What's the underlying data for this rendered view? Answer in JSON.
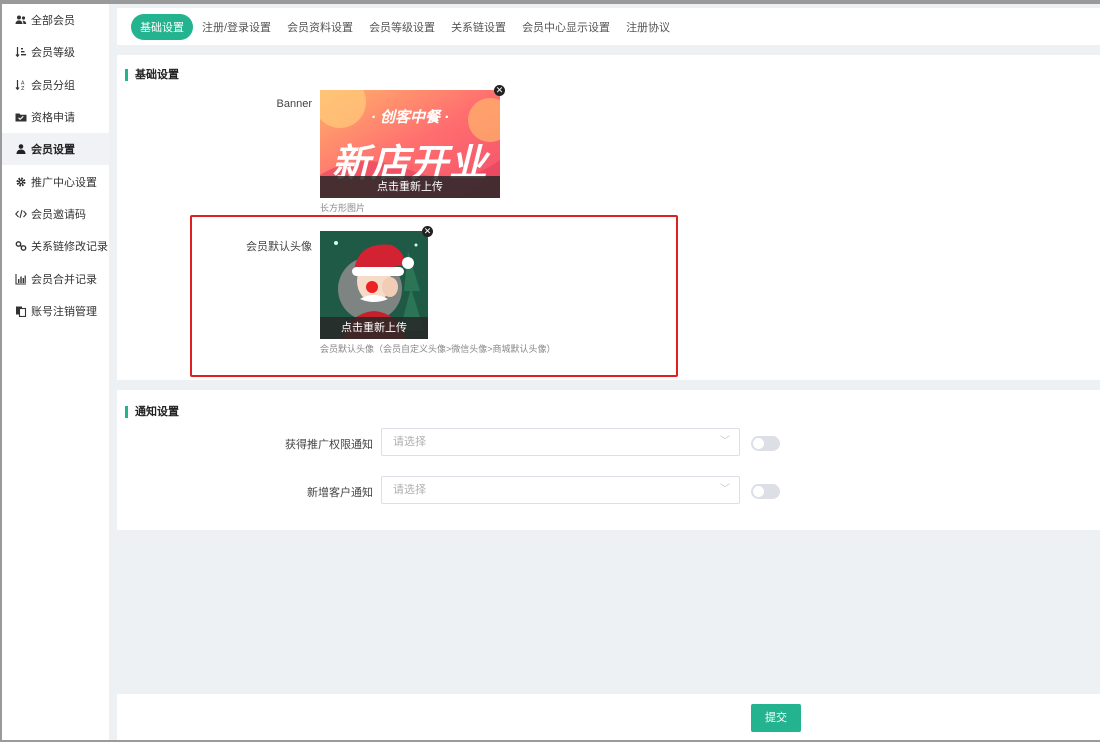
{
  "sidebar": {
    "items": [
      {
        "label": "全部会员",
        "icon": "users-icon"
      },
      {
        "label": "会员等级",
        "icon": "sort-amount-icon"
      },
      {
        "label": "会员分组",
        "icon": "sort-alpha-icon"
      },
      {
        "label": "资格申请",
        "icon": "folder-check-icon"
      },
      {
        "label": "会员设置",
        "icon": "user-icon",
        "active": true
      },
      {
        "label": "推广中心设置",
        "icon": "gear-icon"
      },
      {
        "label": "会员邀请码",
        "icon": "code-icon"
      },
      {
        "label": "关系链修改记录",
        "icon": "link-icon"
      },
      {
        "label": "会员合并记录",
        "icon": "bar-chart-icon"
      },
      {
        "label": "账号注销管理",
        "icon": "copy-icon"
      }
    ]
  },
  "tabs": [
    {
      "label": "基础设置",
      "active": true
    },
    {
      "label": "注册/登录设置"
    },
    {
      "label": "会员资料设置"
    },
    {
      "label": "会员等级设置"
    },
    {
      "label": "关系链设置"
    },
    {
      "label": "会员中心显示设置"
    },
    {
      "label": "注册协议"
    }
  ],
  "basic": {
    "title": "基础设置",
    "banner": {
      "label": "Banner",
      "image_text_top": "· 创客中餐 ·",
      "image_text_main": "新店开业",
      "reupload": "点击重新上传",
      "hint": "长方形图片"
    },
    "avatar": {
      "label": "会员默认头像",
      "reupload": "点击重新上传",
      "hint": "会员默认头像（会员自定义头像>微信头像>商城默认头像）"
    }
  },
  "notify": {
    "title": "通知设置",
    "fields": [
      {
        "label": "获得推广权限通知",
        "placeholder": "请选择",
        "enabled": false
      },
      {
        "label": "新增客户通知",
        "placeholder": "请选择",
        "enabled": false
      }
    ]
  },
  "footer": {
    "submit": "提交"
  },
  "colors": {
    "accent": "#24b38f",
    "highlight": "#e02020"
  }
}
